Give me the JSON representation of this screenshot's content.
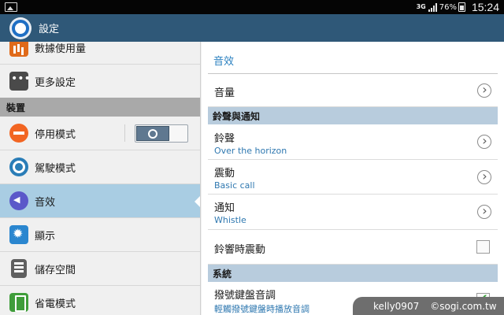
{
  "status_bar": {
    "network": "3G",
    "battery_percent": "76%",
    "time": "15:24"
  },
  "action_bar": {
    "title": "設定",
    "icon": "settings-gear-icon"
  },
  "sidebar": {
    "items_top": [
      {
        "label": "數據使用量",
        "icon": "data-usage-icon"
      },
      {
        "label": "更多設定",
        "icon": "more-settings-icon"
      }
    ],
    "section": "裝置",
    "items_device": [
      {
        "label": "停用模式",
        "icon": "block-mode-icon",
        "toggle": "off"
      },
      {
        "label": "駕駛模式",
        "icon": "driving-mode-icon"
      },
      {
        "label": "音效",
        "icon": "sound-icon",
        "selected": true
      },
      {
        "label": "顯示",
        "icon": "display-icon"
      },
      {
        "label": "儲存空間",
        "icon": "storage-icon"
      },
      {
        "label": "省電模式",
        "icon": "power-saving-icon"
      }
    ]
  },
  "main": {
    "title": "音效",
    "volume_label": "音量",
    "section_ringtones": "鈴聲與通知",
    "ringtone": {
      "label": "鈴聲",
      "value": "Over the horizon"
    },
    "vibration": {
      "label": "震動",
      "value": "Basic call"
    },
    "notification": {
      "label": "通知",
      "value": "Whistle"
    },
    "vibrate_when_ringing": {
      "label": "鈴響時震動",
      "checked": false
    },
    "section_system": "系統",
    "dialing_tone": {
      "label": "撥號鍵盤音調",
      "value": "輕觸撥號鍵盤時播放音調",
      "checked": true
    }
  },
  "watermark": {
    "user": "kelly0907",
    "site": "sogi.com.tw"
  },
  "colors": {
    "action_bar": "#2f5878",
    "selected_item": "#a9cde3",
    "accent_text": "#2a80c0",
    "section_header": "#b8ccdd"
  }
}
